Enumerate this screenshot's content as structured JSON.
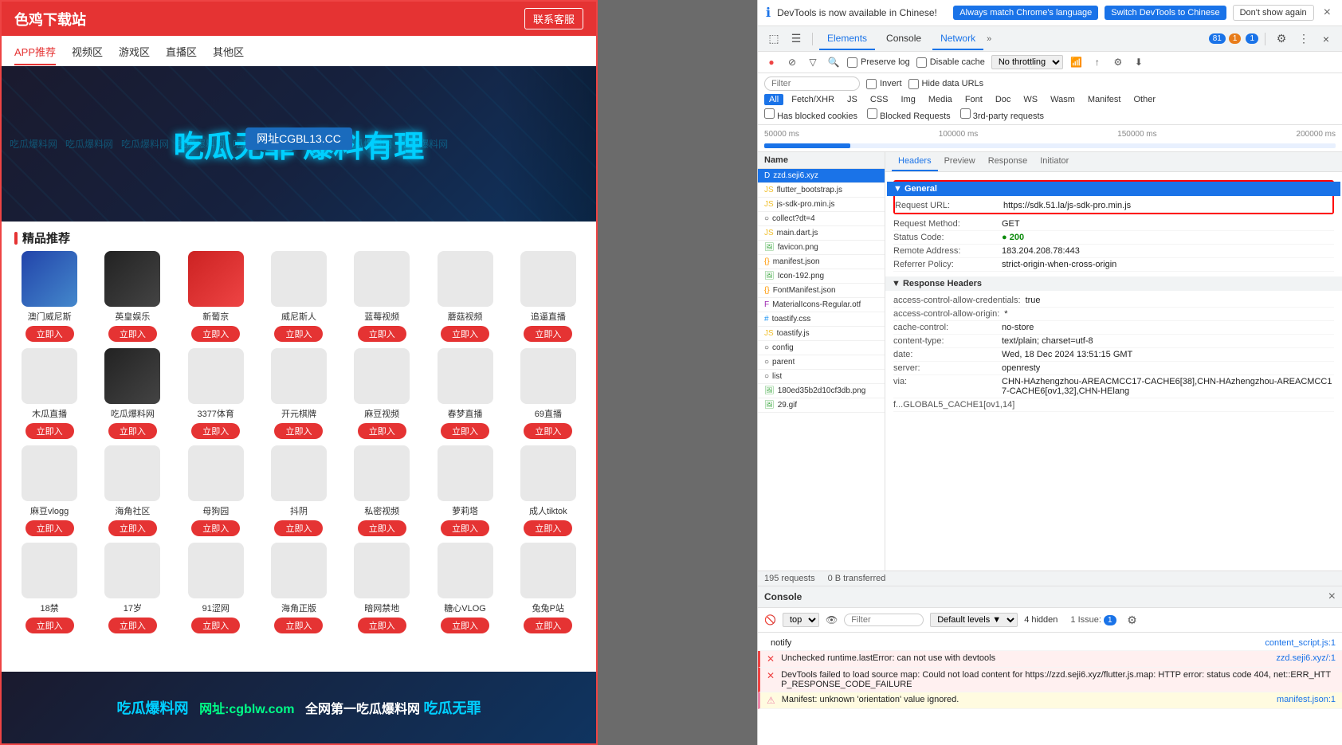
{
  "site": {
    "logo": "色鸡下载站",
    "contact_btn": "联系客服",
    "nav_tabs": [
      "APP推荐",
      "视频区",
      "游戏区",
      "直播区",
      "其他区"
    ],
    "active_tab": "APP推荐",
    "banner_text": "吃瓜无罪 爆料有理",
    "banner_url": "网址CGBL13.CC",
    "banner_watermarks": [
      "吃瓜爆料网",
      "吃瓜爆料网",
      "吃瓜爆料网",
      "吃瓜爆料网",
      "吃瓜爆料网",
      "吃瓜爆料网"
    ],
    "section_title": "精品推荐",
    "apps": [
      {
        "name": "澳门威尼斯",
        "btn": "立即入",
        "color": "colored-1"
      },
      {
        "name": "英皇娱乐",
        "btn": "立即入",
        "color": "colored-2"
      },
      {
        "name": "新葡京",
        "btn": "立即入",
        "color": "colored-3"
      },
      {
        "name": "威尼斯人",
        "btn": "立即入",
        "color": ""
      },
      {
        "name": "蓝莓视频",
        "btn": "立即入",
        "color": ""
      },
      {
        "name": "蘑菇视频",
        "btn": "立即入",
        "color": ""
      },
      {
        "name": "追逼直播",
        "btn": "立即入",
        "color": ""
      },
      {
        "name": "木瓜直播",
        "btn": "立即入",
        "color": ""
      },
      {
        "name": "吃瓜爆料网",
        "btn": "立即入",
        "color": "colored-2"
      },
      {
        "name": "3377体育",
        "btn": "立即入",
        "color": ""
      },
      {
        "name": "开元棋牌",
        "btn": "立即入",
        "color": ""
      },
      {
        "name": "麻豆视频",
        "btn": "立即入",
        "color": ""
      },
      {
        "name": "春梦直播",
        "btn": "立即入",
        "color": ""
      },
      {
        "name": "69直播",
        "btn": "立即入",
        "color": ""
      },
      {
        "name": "麻豆vlogg",
        "btn": "立即入",
        "color": ""
      },
      {
        "name": "海角社区",
        "btn": "立即入",
        "color": ""
      },
      {
        "name": "母狗园",
        "btn": "立即入",
        "color": ""
      },
      {
        "name": "抖阴",
        "btn": "立即入",
        "color": ""
      },
      {
        "name": "私密视频",
        "btn": "立即入",
        "color": ""
      },
      {
        "name": "萝莉塔",
        "btn": "立即入",
        "color": ""
      },
      {
        "name": "成人tiktok",
        "btn": "立即入",
        "color": ""
      },
      {
        "name": "18禁",
        "btn": "立即入",
        "color": ""
      },
      {
        "name": "17岁",
        "btn": "立即入",
        "color": ""
      },
      {
        "name": "91涩网",
        "btn": "立即入",
        "color": ""
      },
      {
        "name": "海角正版",
        "btn": "立即入",
        "color": ""
      },
      {
        "name": "暗网禁地",
        "btn": "立即入",
        "color": ""
      },
      {
        "name": "糖心VLOG",
        "btn": "立即入",
        "color": ""
      },
      {
        "name": "兔兔P站",
        "btn": "立即入",
        "color": ""
      }
    ],
    "bottom_ad_text": "吃瓜爆料网 网址:cgblw.com 全网第一吃瓜爆料网 吃瓜无罪"
  },
  "devtools": {
    "notify_text": "DevTools is now available in Chinese!",
    "notify_btn1": "Always match Chrome's language",
    "notify_btn2": "Switch DevTools to Chinese",
    "notify_btn3": "Don't show again",
    "tabs": [
      "Elements",
      "Console",
      "Network"
    ],
    "active_tab": "Network",
    "badge_blue": "81",
    "badge_warn": "1",
    "badge_msg": "1",
    "network": {
      "preserve_log": "Preserve log",
      "disable_cache": "Disable cache",
      "throttling": "No throttling",
      "filter_placeholder": "Filter",
      "invert": "Invert",
      "hide_data_urls": "Hide data URLs",
      "filter_types": [
        "All",
        "Fetch/XHR",
        "JS",
        "CSS",
        "Img",
        "Media",
        "Font",
        "Doc",
        "WS",
        "Wasm",
        "Manifest",
        "Other"
      ],
      "active_filter": "All",
      "has_blocked": "Has blocked cookies",
      "blocked_requests": "Blocked Requests",
      "third_party": "3rd-party requests",
      "timeline_labels": [
        "50000 ms",
        "100000 ms",
        "150000 ms",
        "200000 ms"
      ],
      "requests_count": "195 requests",
      "transferred": "0 B transferred"
    },
    "requests": [
      {
        "name": "zzd.seji6.xyz",
        "type": "doc",
        "selected": true
      },
      {
        "name": "flutter_bootstrap.js",
        "type": "js"
      },
      {
        "name": "js-sdk-pro.min.js",
        "type": "js"
      },
      {
        "name": "collect?dt=4",
        "type": "other"
      },
      {
        "name": "main.dart.js",
        "type": "js"
      },
      {
        "name": "favicon.png",
        "type": "img"
      },
      {
        "name": "manifest.json",
        "type": "json"
      },
      {
        "name": "Icon-192.png",
        "type": "img"
      },
      {
        "name": "FontManifest.json",
        "type": "json"
      },
      {
        "name": "MaterialIcons-Regular.otf",
        "type": "font"
      },
      {
        "name": "toastify.css",
        "type": "css"
      },
      {
        "name": "toastify.js",
        "type": "js"
      },
      {
        "name": "config",
        "type": "other"
      },
      {
        "name": "parent",
        "type": "other"
      },
      {
        "name": "list",
        "type": "other"
      },
      {
        "name": "180ed35b2d10cf3db.png",
        "type": "img"
      },
      {
        "name": "29.gif",
        "type": "img"
      }
    ],
    "details": {
      "tabs": [
        "Headers",
        "Preview",
        "Response",
        "Initiator"
      ],
      "active_tab": "Headers",
      "general_title": "▼ General",
      "request_url_label": "Request URL:",
      "request_url_val": "https://sdk.51.la/js-sdk-pro.min.js",
      "request_method_label": "Request Method:",
      "request_method_val": "GET",
      "status_code_label": "Status Code:",
      "status_code_val": "200",
      "remote_address_label": "Remote Address:",
      "remote_address_val": "183.204.208.78:443",
      "referrer_policy_label": "Referrer Policy:",
      "referrer_policy_val": "strict-origin-when-cross-origin",
      "response_headers_title": "▼ Response Headers",
      "headers": [
        {
          "key": "access-control-allow-credentials:",
          "val": "true"
        },
        {
          "key": "access-control-allow-origin:",
          "val": "*"
        },
        {
          "key": "cache-control:",
          "val": "no-store"
        },
        {
          "key": "content-type:",
          "val": "text/plain; charset=utf-8"
        },
        {
          "key": "date:",
          "val": "Wed, 18 Dec 2024 13:51:15 GMT"
        },
        {
          "key": "server:",
          "val": "openresty"
        },
        {
          "key": "via:",
          "val": "CHN-HAzhengzhou-AREACMCC17-CACHE6[38],CHN-HAzhengzhou-AREACMCC17-CACHE6[ov1,32],CHN-HElang"
        },
        {
          "key": "f...GLOBAL5_CACHE1[ov1,14]",
          "val": ""
        }
      ]
    },
    "console": {
      "title": "Console",
      "toolbar_level": "top",
      "filter_placeholder": "Filter",
      "default_levels": "Default levels ▼",
      "hidden_count": "4 hidden",
      "issues": "1 Issue:",
      "issues_badge": "1",
      "logs": [
        {
          "type": "info",
          "text": "notify",
          "link": "content_script.js:1"
        },
        {
          "type": "error",
          "text": "Unchecked runtime.lastError: can not use with devtools",
          "link": "zzd.seji6.xyz/:1"
        },
        {
          "type": "error",
          "text": "DevTools failed to load source map: Could not load content for https://zzd.seji6.xyz/flutter.js.map: HTTP error: status code 404, net::ERR_HTTP_RESPONSE_CODE_FAILURE",
          "link": ""
        },
        {
          "type": "warn",
          "text": "Manifest: unknown 'orientation' value ignored.",
          "link": "manifest.json:1"
        }
      ]
    }
  },
  "middle_gap": {
    "color": "#6b6b6b"
  }
}
